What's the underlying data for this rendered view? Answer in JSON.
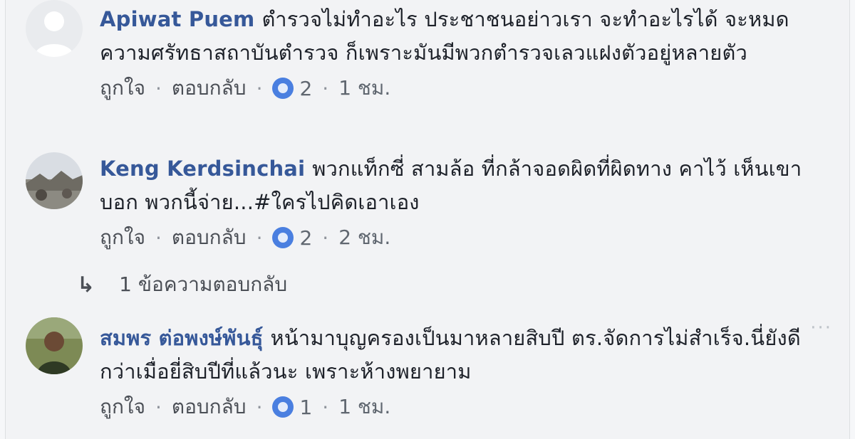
{
  "comments": [
    {
      "author": "Apiwat Puem",
      "text": "ตำรวจไม่ทำอะไร ประชาชนอย่าวเรา จะทำอะไรได้ จะหมดความศรัทธาสถาบันตำรวจ ก็เพราะมันมีพวกตำรวจเลวแฝงตัวอยู่หลายตัว",
      "like_label": "ถูกใจ",
      "reply_label": "ตอบกลับ",
      "reaction_count": "2",
      "time": "1 ชม."
    },
    {
      "author": "Keng Kerdsinchai",
      "text": "พวกแท็กซี่ สามล้อ ที่กล้าจอดผิดที่ผิดทาง คาไว้ เห็นเขาบอก พวกนี้จ่าย...#ใครไปคิดเอาเอง",
      "like_label": "ถูกใจ",
      "reply_label": "ตอบกลับ",
      "reaction_count": "2",
      "time": "2 ชม.",
      "replies_label": "1 ข้อความตอบกลับ"
    },
    {
      "author": "สมพร ต่อพงษ์พันธุ์",
      "text": "หน้ามาบุญครองเป็นมาหลายสิบปี ตร.จัดการไม่สำเร็จ.นี่ยังดีกว่าเมื่อยี่สิบปีที่แล้วนะ เพราะห้างพยายาม",
      "like_label": "ถูกใจ",
      "reply_label": "ตอบกลับ",
      "reaction_count": "1",
      "time": "1 ชม."
    }
  ],
  "colors": {
    "author": "#365899",
    "text": "#1d2129",
    "meta": "#606770",
    "reaction": "#4a7fe0"
  },
  "icons": {
    "reaction": "like-reaction-icon",
    "reply_arrow": "reply-arrow-icon",
    "more": "more-options-icon"
  }
}
